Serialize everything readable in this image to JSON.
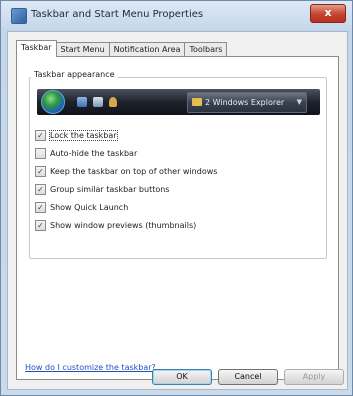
{
  "window": {
    "title": "Taskbar and Start Menu Properties",
    "close_glyph": "x"
  },
  "tabs": [
    {
      "label": "Taskbar",
      "active": true
    },
    {
      "label": "Start Menu",
      "active": false
    },
    {
      "label": "Notification Area",
      "active": false
    },
    {
      "label": "Toolbars",
      "active": false
    }
  ],
  "group": {
    "label": "Taskbar appearance"
  },
  "preview": {
    "task_button_label": "2 Windows Explorer",
    "task_button_arrow": "▼",
    "icons": [
      "start-orb-icon",
      "desktop-icon",
      "switch-windows-icon",
      "media-icon",
      "folder-icon"
    ]
  },
  "options": [
    {
      "label": "Lock the taskbar",
      "checked": true
    },
    {
      "label": "Auto-hide the taskbar",
      "checked": false
    },
    {
      "label": "Keep the taskbar on top of other windows",
      "checked": true
    },
    {
      "label": "Group similar taskbar buttons",
      "checked": true
    },
    {
      "label": "Show Quick Launch",
      "checked": true
    },
    {
      "label": "Show window previews (thumbnails)",
      "checked": true
    }
  ],
  "check_glyph": "✓",
  "help_link": "How do I customize the taskbar?",
  "buttons": {
    "ok": "OK",
    "cancel": "Cancel",
    "apply": "Apply"
  }
}
